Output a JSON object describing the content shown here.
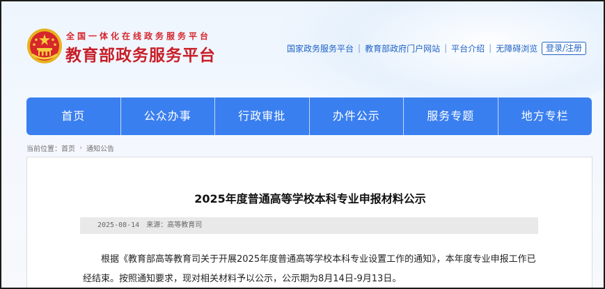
{
  "header": {
    "tagline": "全国一体化在线政务服务平台",
    "site_title": "教育部政务服务平台",
    "links": [
      "国家政务服务平台",
      "教育部政府门户网站",
      "平台介绍",
      "无障碍浏览"
    ],
    "login_label": "登录/注册"
  },
  "nav": {
    "items": [
      "首页",
      "公众办事",
      "行政审批",
      "办件公示",
      "服务专题",
      "地方专栏"
    ]
  },
  "breadcrumb": {
    "prefix": "当前位置：",
    "items": [
      "首页",
      "通知公告"
    ]
  },
  "article": {
    "title": "2025年度普通高等学校本科专业申报材料公示",
    "date": "2025-08-14",
    "source": "来源：高等教育司",
    "paragraph": "根据《教育部高等教育司关于开展2025年度普通高等学校本科专业设置工作的通知》，本年度专业申报工作已经结束。按照通知要求，现对相关材料予以公示，公示期为8月14日-9月13日。"
  },
  "colors": {
    "brand_red": "#c81e28",
    "nav_blue": "#3a7ff0",
    "link_blue": "#1f62c4"
  },
  "icons": [
    "national-emblem-icon",
    "chevron-right-icon"
  ]
}
